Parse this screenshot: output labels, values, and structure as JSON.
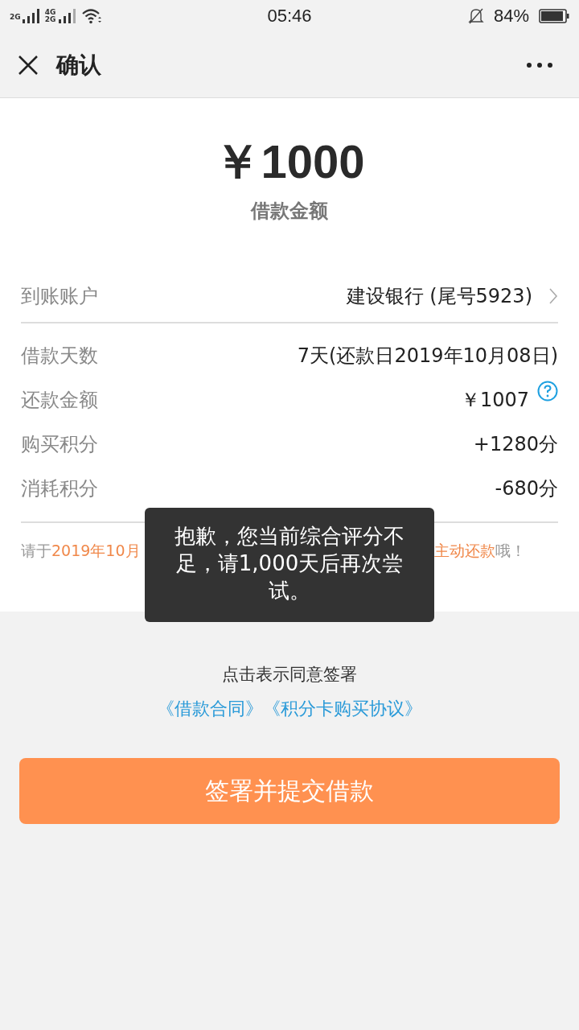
{
  "status_bar": {
    "network_1": "2G",
    "network_2": "4G",
    "network_3": "2G",
    "time": "05:46",
    "battery": "84%"
  },
  "header": {
    "title": "确认"
  },
  "amount": {
    "value": "￥1000",
    "label": "借款金额"
  },
  "account": {
    "label": "到账账户",
    "value": "建设银行 (尾号5923)"
  },
  "details": [
    {
      "label": "借款天数",
      "value": "7天(还款日2019年10月08日)",
      "help": false
    },
    {
      "label": "还款金额",
      "value": "￥1007",
      "help": true
    },
    {
      "label": "购买积分",
      "value": "+1280分",
      "help": false
    },
    {
      "label": "消耗积分",
      "value": "-680分",
      "help": false
    }
  ],
  "notice_left": [
    {
      "text": "请于",
      "highlight": false
    },
    {
      "text": "2019年10月",
      "highlight": true
    }
  ],
  "notice_right": [
    {
      "text": "主动还款",
      "highlight": true
    },
    {
      "text": "哦！",
      "highlight": false
    }
  ],
  "agreement": {
    "text": "点击表示同意签署",
    "links": [
      "《借款合同》",
      "《积分卡购买协议》"
    ]
  },
  "submit_button": "签署并提交借款",
  "toast": "抱歉，您当前综合评分不足，请1,000天后再次尝试。"
}
